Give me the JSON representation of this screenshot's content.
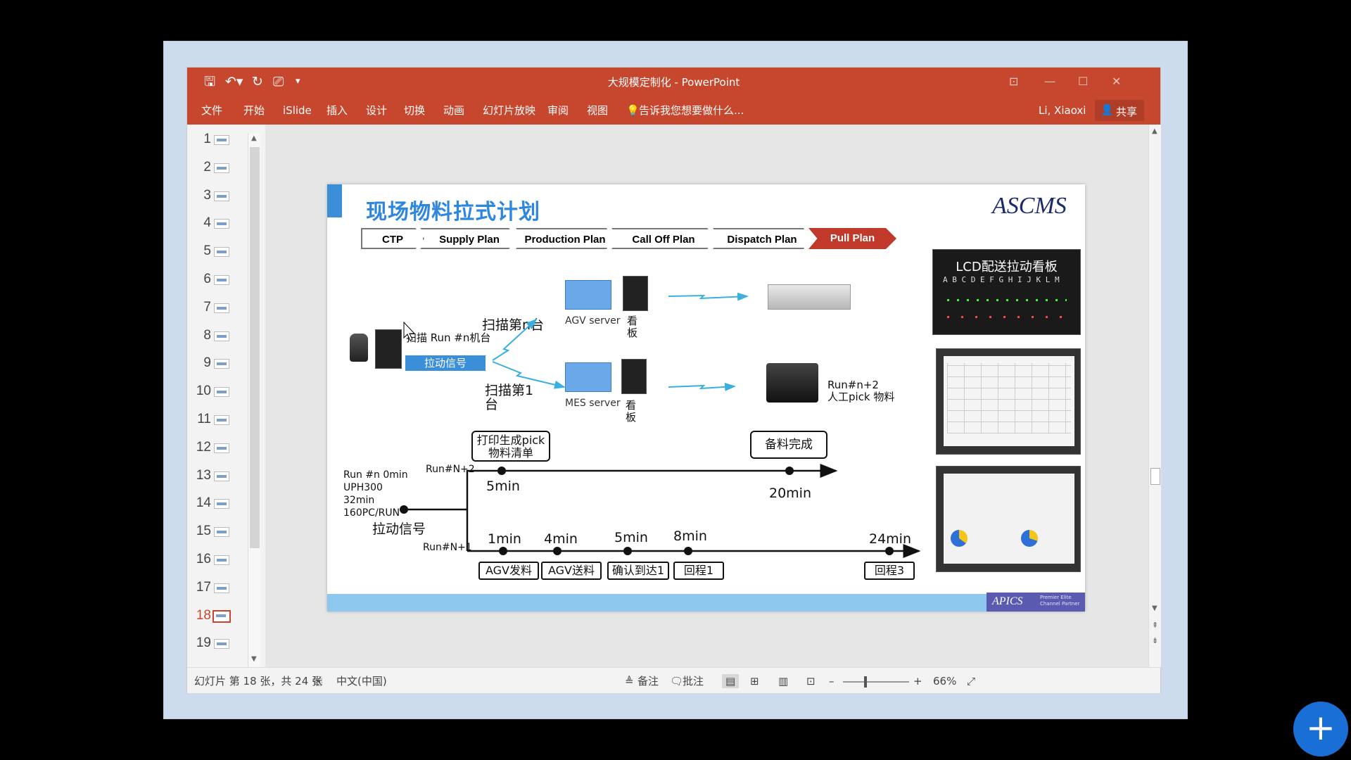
{
  "titlebar": {
    "title": "大规模定制化 - PowerPoint",
    "user": "Li, Xiaoxi",
    "share": "共享"
  },
  "ribbon": {
    "tabs": [
      "文件",
      "开始",
      "iSlide",
      "插入",
      "设计",
      "切换",
      "动画",
      "幻灯片放映",
      "审阅",
      "视图"
    ],
    "tellme": "告诉我您想要做什么..."
  },
  "thumbs": {
    "numbers": [
      "1",
      "2",
      "3",
      "4",
      "5",
      "6",
      "7",
      "8",
      "9",
      "10",
      "11",
      "12",
      "13",
      "14",
      "15",
      "16",
      "17",
      "18",
      "19"
    ],
    "selected": "18"
  },
  "status": {
    "slide_info": "幻灯片 第 18 张，共 24 张",
    "language": "中文(中国)",
    "notes": "备注",
    "comments": "批注",
    "zoom": "66%",
    "zoom_minus": "–",
    "zoom_plus": "+"
  },
  "slide": {
    "title": "现场物料拉式计划",
    "logo": "ASCMS",
    "footer_logo": "APICS",
    "footer_logo_sub": "Premier Elite Channel Partner",
    "process": [
      "CTP",
      "Supply Plan",
      "Production Plan",
      "Call Off Plan",
      "Dispatch Plan",
      "Pull Plan"
    ],
    "photo_caption": "LCD配送拉动看板",
    "led_letters": "A B C D E F G H I J K L M",
    "scan_run": "扫描 Run #n机台",
    "pull_signal_button": "拉动信号",
    "scan_nth": "扫描第n台",
    "scan_first": "扫描第1台",
    "agv_server": "AGV server",
    "mes_server": "MES server",
    "kanban1": "看板",
    "kanban2": "看板",
    "run_n2": "Run#n+2",
    "manual_pick": "人工pick 物料",
    "print_box": "打印生成pick物料清单",
    "ready_box": "备料完成",
    "run_info": [
      "Run #n 0min",
      "UPH300",
      "32min",
      "160PC/RUN"
    ],
    "pull_signal_label": "拉动信号",
    "run_n_plus_2": "Run#N+2",
    "run_n_plus_1": "Run#N+1",
    "t_5min_top": "5min",
    "t_20min": "20min",
    "t_1min": "1min",
    "t_4min": "4min",
    "t_5min": "5min",
    "t_8min": "8min",
    "t_24min": "24min",
    "agv_issue": "AGV发料",
    "agv_deliver": "AGV送料",
    "confirm_arrive": "确认到达1",
    "return1": "回程1",
    "return3": "回程3"
  },
  "colors": {
    "accent": "#c7472e",
    "slide_blue": "#3a8fd8",
    "title_blue": "#2e86de",
    "pull_plan_red": "#c0392b"
  },
  "icons": {
    "fab": "plus-icon"
  }
}
